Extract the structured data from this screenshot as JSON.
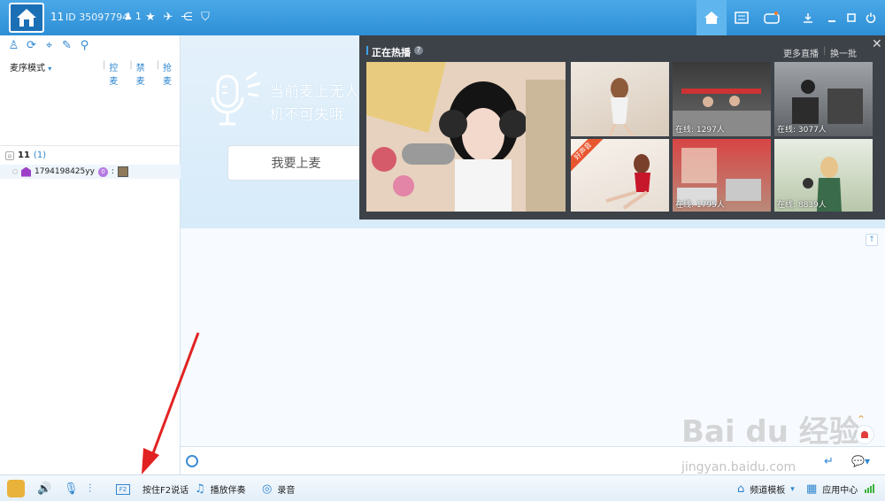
{
  "titlebar": {
    "channel": "11",
    "id": "ID 35097794",
    "online_count": "1"
  },
  "left": {
    "mode": "麦序模式",
    "mode_caret": "▾",
    "links": [
      "控麦",
      "禁麦",
      "抢麦"
    ],
    "root_name": "11",
    "root_count": "(1)",
    "user_name": "1794198425yy",
    "user_badge": "0",
    "user_suffix": ":"
  },
  "mic": {
    "line1": "当前麦上无人",
    "line2": "机不可失哦",
    "button": "我要上麦"
  },
  "hot": {
    "title": "正在热播",
    "more": "更多直播",
    "sep": "|",
    "change": "换一批",
    "ribbon": "好声音",
    "online": [
      "在线: 1297人",
      "在线: 3077人",
      "在线: 1795人",
      "在线: 8839人"
    ]
  },
  "bottom": {
    "f2_key": "F2",
    "push_to_talk": "按住F2说话",
    "play_music": "播放伴奏",
    "record": "录音",
    "channel_template": "频道模板",
    "app_center": "应用中心"
  },
  "watermark": {
    "logo_text": "Bai du 经验",
    "url": "jingyan.baidu.com"
  }
}
